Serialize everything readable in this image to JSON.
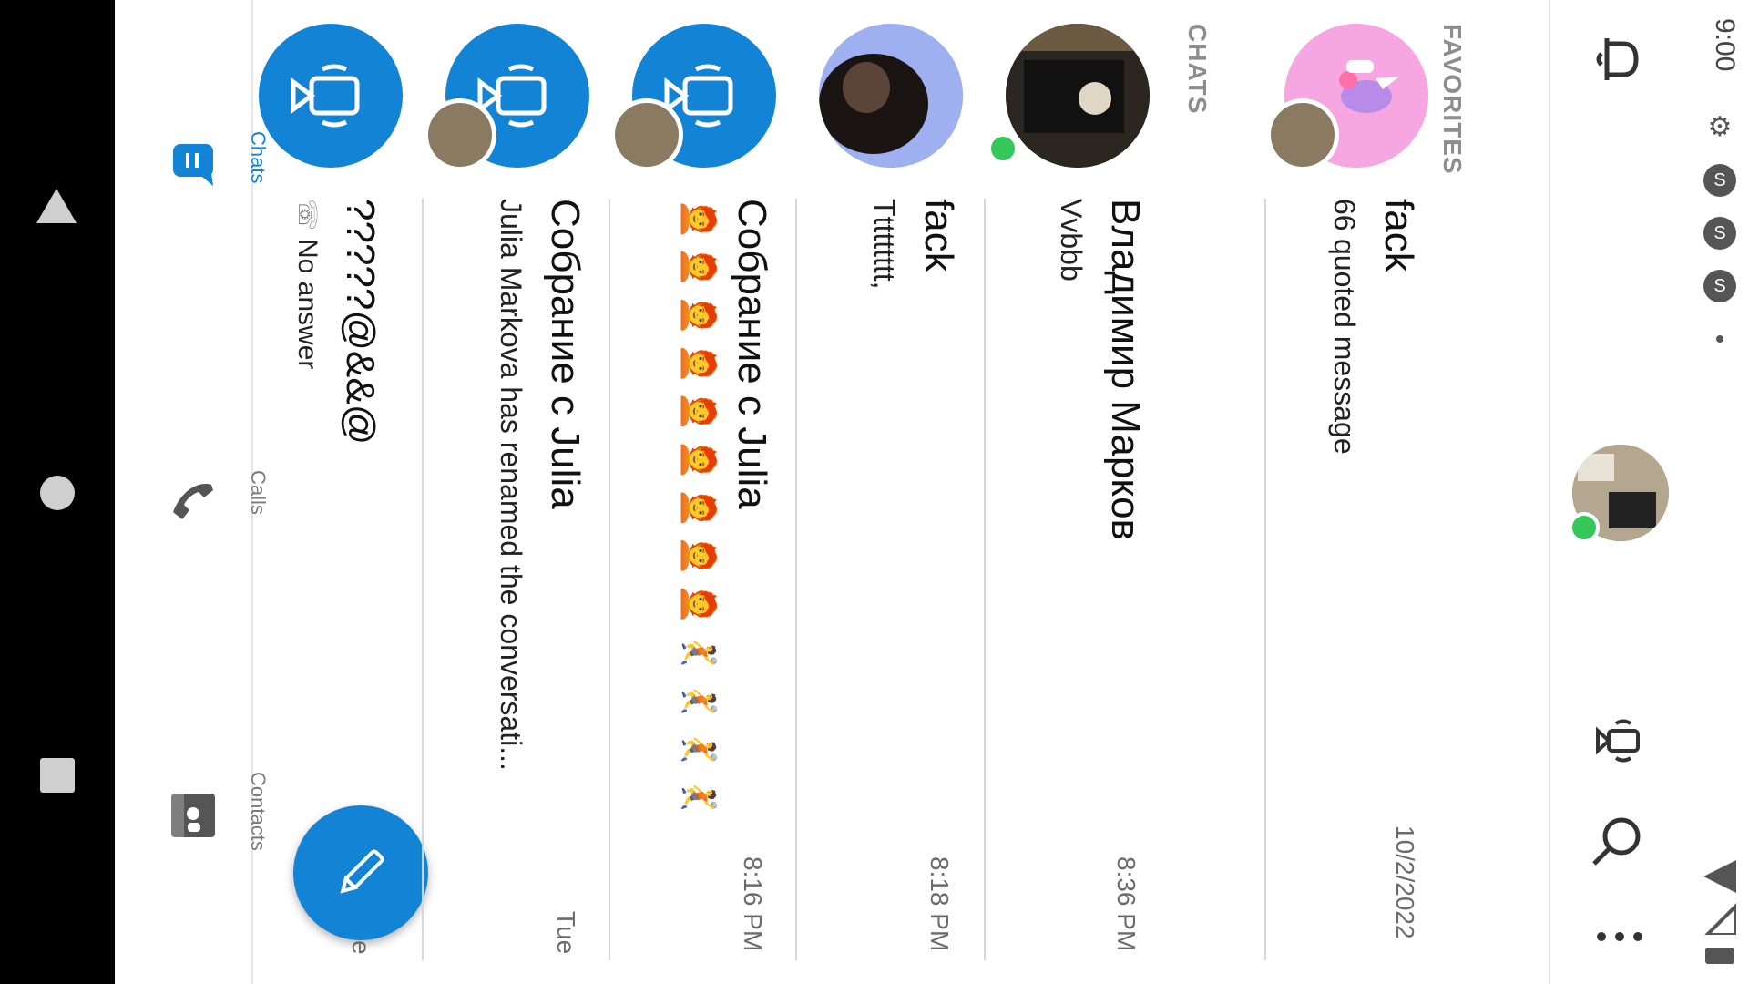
{
  "status_bar": {
    "time": "9:00",
    "icons": [
      "gear-icon",
      "skype-notification-icon",
      "skype-notification-icon",
      "skype-notification-icon",
      "dot-icon",
      "wifi-icon",
      "signal-icon",
      "battery-icon"
    ]
  },
  "header": {
    "icons": [
      "bell-icon",
      "profile-avatar",
      "device-call-icon",
      "search-icon",
      "more-icon"
    ]
  },
  "favorites_label": "FAVORITES",
  "chats_label": "CHATS",
  "conversations": [
    {
      "name": "fack",
      "preview": "quoted message",
      "preview_icon": "quote-icon",
      "time": "10/2/2022",
      "avatar": "unicorn-avatar"
    },
    {
      "name": "Владимир Марков",
      "preview": "Vvbbb",
      "time": "8:36 PM",
      "avatar": "photo-avatar",
      "online": true
    },
    {
      "name": "fack",
      "preview": "Ttttttttt,",
      "time": "8:18 PM",
      "avatar": "photo-avatar"
    },
    {
      "name": "Собрание с Julia",
      "preview": "🧑‍🦰🧑‍🦰🧑‍🦰🧑‍🦰🧑‍🦰🧑‍🦰🧑‍🦰🧑‍🦰🧑‍🦰🤾🤾🤾🤾",
      "time": "8:16 PM",
      "avatar": "group-call-avatar"
    },
    {
      "name": "Собрание с Julia",
      "preview": "Julia Markova has renamed the conversati...",
      "time": "Tue",
      "avatar": "group-call-avatar"
    },
    {
      "name": "?????@&&@",
      "preview": "No answer",
      "preview_icon": "missed-call-icon",
      "time": "e",
      "avatar": "group-call-avatar"
    }
  ],
  "tabs": [
    {
      "label": "Chats",
      "icon": "chat-icon",
      "active": true
    },
    {
      "label": "Calls",
      "icon": "phone-icon",
      "active": false
    },
    {
      "label": "Contacts",
      "icon": "contacts-icon",
      "active": false
    }
  ],
  "fab_icon": "pencil-icon",
  "colors": {
    "accent": "#1383d6",
    "online": "#35c759"
  }
}
